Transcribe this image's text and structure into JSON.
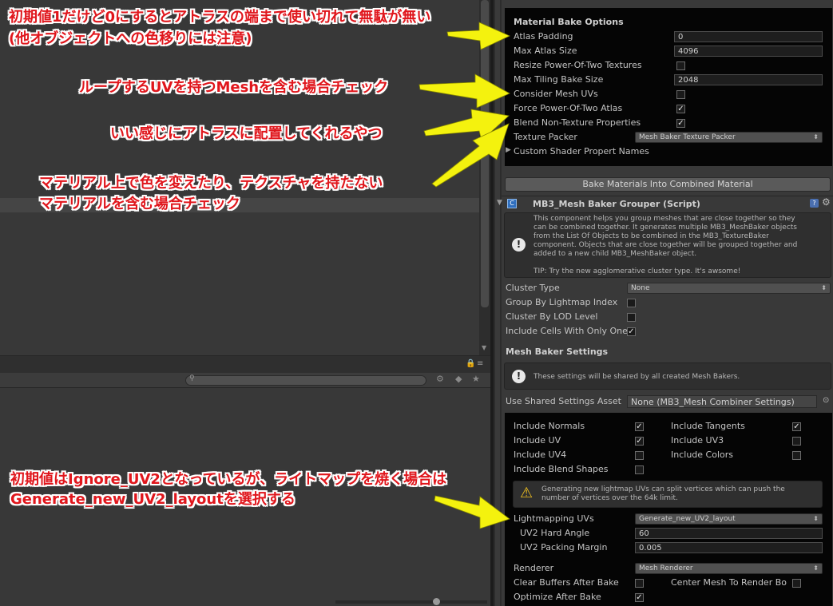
{
  "annotations": {
    "a1_line1": "初期値1だけど0にするとアトラスの端まで使い切れて無駄が無い",
    "a1_line2": "(他オブジェクトへの色移りには注意)",
    "a2": "ループするUVを持つMeshを含む場合チェック",
    "a3": "いい感じにアトラスに配置してくれるやつ",
    "a4_line1": "マテリアル上で色を変えたり、テクスチャを持たない",
    "a4_line2": "マテリアルを含む場合チェック",
    "a5_line1": "初期値はIgnore_UV2となっているが、ライトマップを焼く場合は",
    "a5_line2": "Generate_new_UV2_layoutを選択する"
  },
  "material_bake": {
    "header": "Material Bake Options",
    "atlas_padding_label": "Atlas Padding",
    "atlas_padding_value": "0",
    "max_atlas_size_label": "Max Atlas Size",
    "max_atlas_size_value": "4096",
    "resize_pot_label": "Resize Power-Of-Two Textures",
    "resize_pot_checked": false,
    "max_tiling_label": "Max Tiling Bake Size",
    "max_tiling_value": "2048",
    "consider_mesh_uvs_label": "Consider Mesh UVs",
    "consider_mesh_uvs_checked": false,
    "force_pot_label": "Force Power-Of-Two Atlas",
    "force_pot_checked": true,
    "blend_non_texture_label": "Blend Non-Texture Properties",
    "blend_non_texture_checked": true,
    "texture_packer_label": "Texture Packer",
    "texture_packer_value": "Mesh Baker Texture Packer",
    "custom_shader_label": "Custom Shader Propert Names",
    "bake_button": "Bake Materials Into Combined Material"
  },
  "grouper": {
    "component_title": "MB3_Mesh Baker Grouper (Script)",
    "help_text_1": "This component helps you group meshes that are close together so they",
    "help_text_2": "can be combined together. It generates multiple MB3_MeshBaker objects",
    "help_text_3": "from the List Of Objects to be combined in the MB3_TextureBaker",
    "help_text_4": "component. Objects that are close together will be grouped together and",
    "help_text_5": "added to a new child MB3_MeshBaker object.",
    "tip_text": "TIP: Try the new agglomerative cluster type. It's awsome!",
    "cluster_type_label": "Cluster Type",
    "cluster_type_value": "None",
    "group_by_lightmap_label": "Group By Lightmap Index",
    "group_by_lightmap_checked": false,
    "cluster_by_lod_label": "Cluster By LOD Level",
    "cluster_by_lod_checked": false,
    "include_cells_label": "Include Cells With Only One",
    "include_cells_checked": true
  },
  "mesh_baker": {
    "header": "Mesh Baker Settings",
    "shared_info": "These settings will be shared by all created Mesh Bakers.",
    "use_shared_label": "Use Shared Settings Asset",
    "use_shared_value": "None (MB3_Mesh Combiner Settings)",
    "include_normals_label": "Include Normals",
    "include_normals_checked": true,
    "include_tangents_label": "Include Tangents",
    "include_tangents_checked": true,
    "include_uv_label": "Include UV",
    "include_uv_checked": true,
    "include_uv3_label": "Include UV3",
    "include_uv3_checked": false,
    "include_uv4_label": "Include UV4",
    "include_uv4_checked": false,
    "include_colors_label": "Include Colors",
    "include_colors_checked": false,
    "include_blend_label": "Include Blend Shapes",
    "include_blend_checked": false,
    "warning_1": "Generating new lightmap UVs can split vertices which can push the",
    "warning_2": "number of vertices over the 64k limit.",
    "lightmapping_label": "Lightmapping UVs",
    "lightmapping_value": "Generate_new_UV2_layout",
    "hard_angle_label": "UV2 Hard Angle",
    "hard_angle_value": "60",
    "packing_margin_label": "UV2 Packing Margin",
    "packing_margin_value": "0.005",
    "renderer_label": "Renderer",
    "renderer_value": "Mesh Renderer",
    "clear_buffers_label": "Clear Buffers After Bake",
    "clear_buffers_checked": false,
    "center_mesh_label": "Center Mesh To Render Bo",
    "center_mesh_checked": false,
    "optimize_label": "Optimize After Bake",
    "optimize_checked": true
  },
  "colors": {
    "annotation_text": "#e0161c",
    "arrow_fill": "#f4f20e",
    "panel_bg": "#383838",
    "dark_box": "#050505"
  }
}
